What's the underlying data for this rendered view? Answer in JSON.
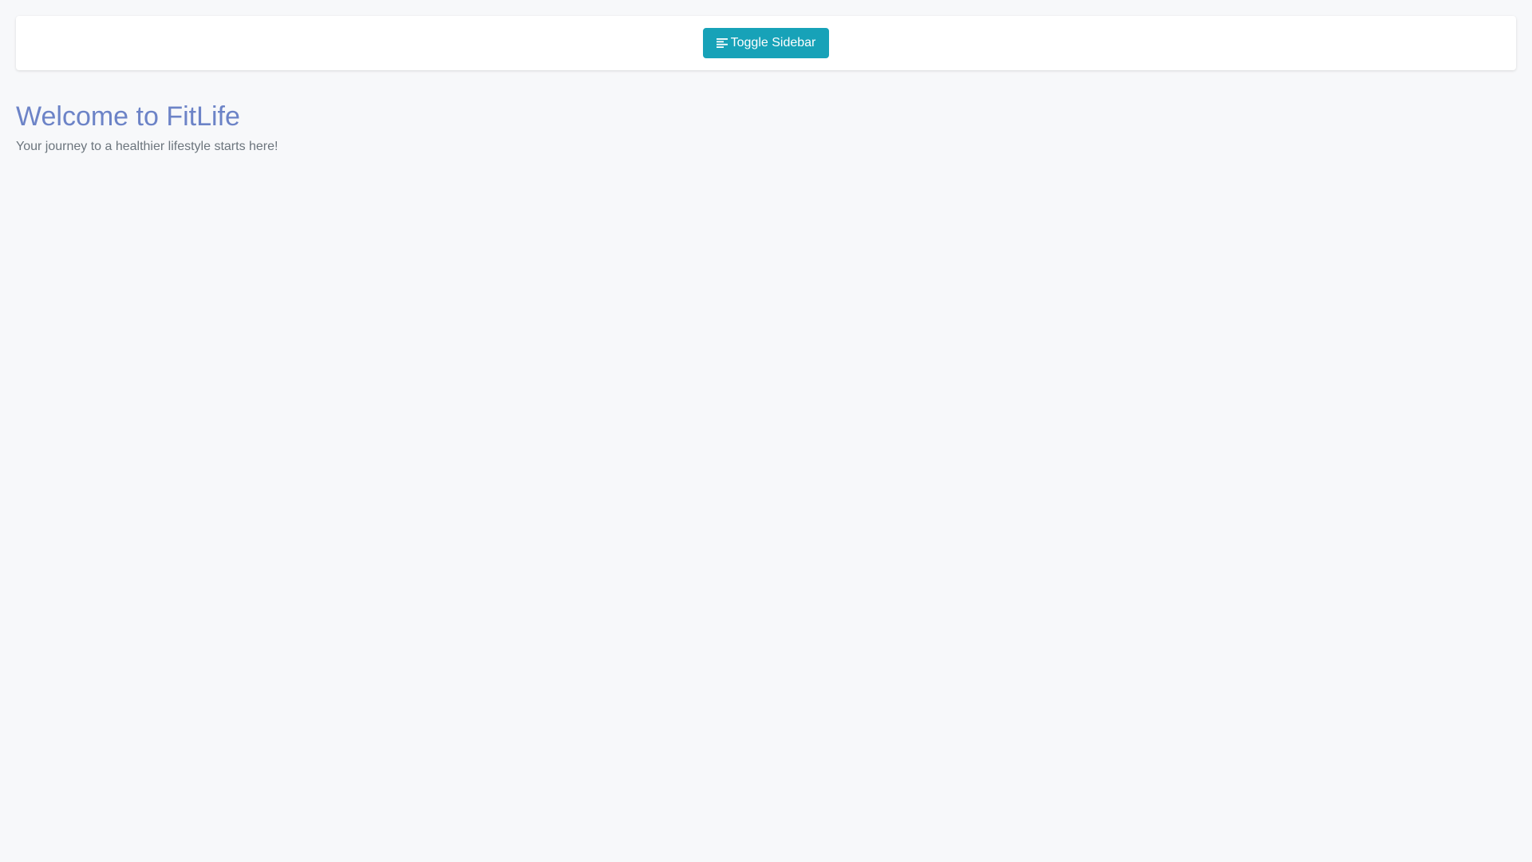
{
  "navbar": {
    "toggle_button": {
      "label": "Toggle Sidebar",
      "icon": "align-left-icon"
    }
  },
  "hero": {
    "title": "Welcome to FitLife",
    "subtitle": "Your journey to a healthier lifestyle starts here!"
  },
  "colors": {
    "background": "#f7f8fa",
    "button_accent": "#17a2b8",
    "title": "#6c83c7",
    "subtitle": "#6c757d"
  }
}
